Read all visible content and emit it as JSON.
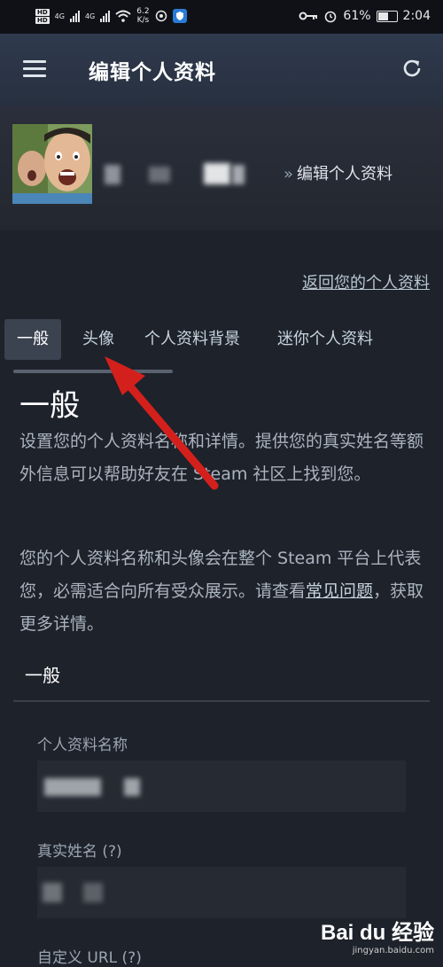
{
  "status_bar": {
    "badge_top": "HD",
    "badge_bottom": "HD",
    "net1": "4G",
    "net2": "4G",
    "speed_value": "6.2",
    "speed_unit": "K/s",
    "battery_percent": "61%",
    "battery_level": 0.61,
    "time": "2:04"
  },
  "app": {
    "title": "编辑个人资料"
  },
  "profile": {
    "edit_link": "编辑个人资料",
    "back_link": "返回您的个人资料"
  },
  "tabs": [
    {
      "label": "一般",
      "active": true
    },
    {
      "label": "头像",
      "active": false
    },
    {
      "label": "个人资料背景",
      "active": false
    },
    {
      "label": "迷你个人资料",
      "active": false
    }
  ],
  "general": {
    "title": "一般",
    "desc1": "设置您的个人资料名称和详情。提供您的真实姓名等额外信息可以帮助好友在 Steam 社区上找到您。",
    "desc2_before": "您的个人资料名称和头像会在整个 Steam 平台上代表您，必需适合向所有受众展示。请查看",
    "faq_link": "常见问题",
    "desc2_after": "，获取更多详情。",
    "sub_heading": "一般",
    "fields": {
      "profile_name_label": "个人资料名称",
      "real_name_label": "真实姓名 (?)",
      "custom_url_label": "自定义 URL (?)"
    }
  },
  "watermark": {
    "main": "Bai du 经验",
    "sub": "jingyan.baidu.com"
  },
  "colors": {
    "background": "#1e222b",
    "header": "#2f3a4e",
    "annotation_arrow": "#d4201c"
  }
}
